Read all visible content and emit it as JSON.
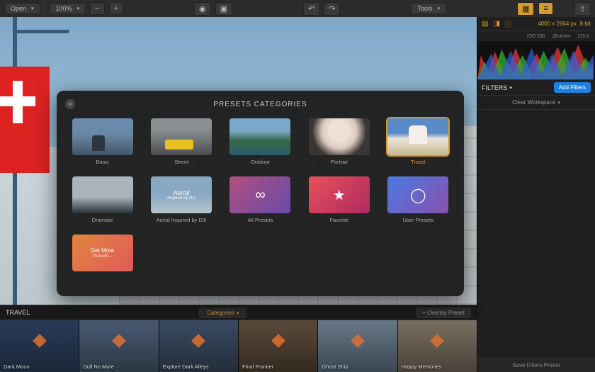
{
  "toolbar": {
    "open": "Open",
    "zoom": "100%",
    "zoom_out": "−",
    "zoom_in": "+",
    "eye": "◉",
    "compare": "▣",
    "undo": "↶",
    "redo": "↷",
    "tools": "Tools",
    "grid_icon": "▦",
    "sliders_icon": "≡",
    "export_icon": "⇪"
  },
  "sidebar": {
    "icons": {
      "layers": "▤",
      "hist": "◨",
      "info": "ⓘ"
    },
    "dimensions": "4000 x 2664 px",
    "bit": "8-bit",
    "meta": {
      "iso": "ISO 200",
      "focal": "28.4mm",
      "val": "115.6"
    },
    "filters_label": "FILTERS",
    "add_filters": "Add Filters",
    "clear": "Clear Workspace",
    "save_preset": "Save Filters Preset"
  },
  "modal": {
    "title": "PRESETS CATEGORIES",
    "close": "✕",
    "items": [
      {
        "label": "Basic",
        "bg": "bg-basic"
      },
      {
        "label": "Street",
        "bg": "bg-street"
      },
      {
        "label": "Outdoor",
        "bg": "bg-outdoor"
      },
      {
        "label": "Portrait",
        "bg": "bg-portrait"
      },
      {
        "label": "Travel",
        "bg": "bg-travel",
        "selected": true
      },
      {
        "label": "Dramatic",
        "bg": "bg-dramatic"
      },
      {
        "label": "Aerial Inspired by DJI",
        "bg": "bg-aerial",
        "overlay": "Aerial"
      },
      {
        "label": "All Presets",
        "bg": "bg-all",
        "icon": "∞"
      },
      {
        "label": "Favorite",
        "bg": "bg-fav",
        "icon": "★"
      },
      {
        "label": "User Presets",
        "bg": "bg-user",
        "icon": "◯"
      }
    ],
    "getmore": "Get More",
    "getmore_sub": "Presets..."
  },
  "strip": {
    "title": "TRAVEL",
    "categories_btn": "Categories",
    "overlay_btn": "+ Overlay Preset",
    "thumbs": [
      {
        "label": "Dark Moon",
        "tint": "t0"
      },
      {
        "label": "Dull No More",
        "tint": "t1"
      },
      {
        "label": "Explore Dark Alleys",
        "tint": "t2"
      },
      {
        "label": "Final Frontier",
        "tint": "t3"
      },
      {
        "label": "Ghost Ship",
        "tint": "t4"
      },
      {
        "label": "Happy Memories",
        "tint": "t5"
      }
    ]
  }
}
